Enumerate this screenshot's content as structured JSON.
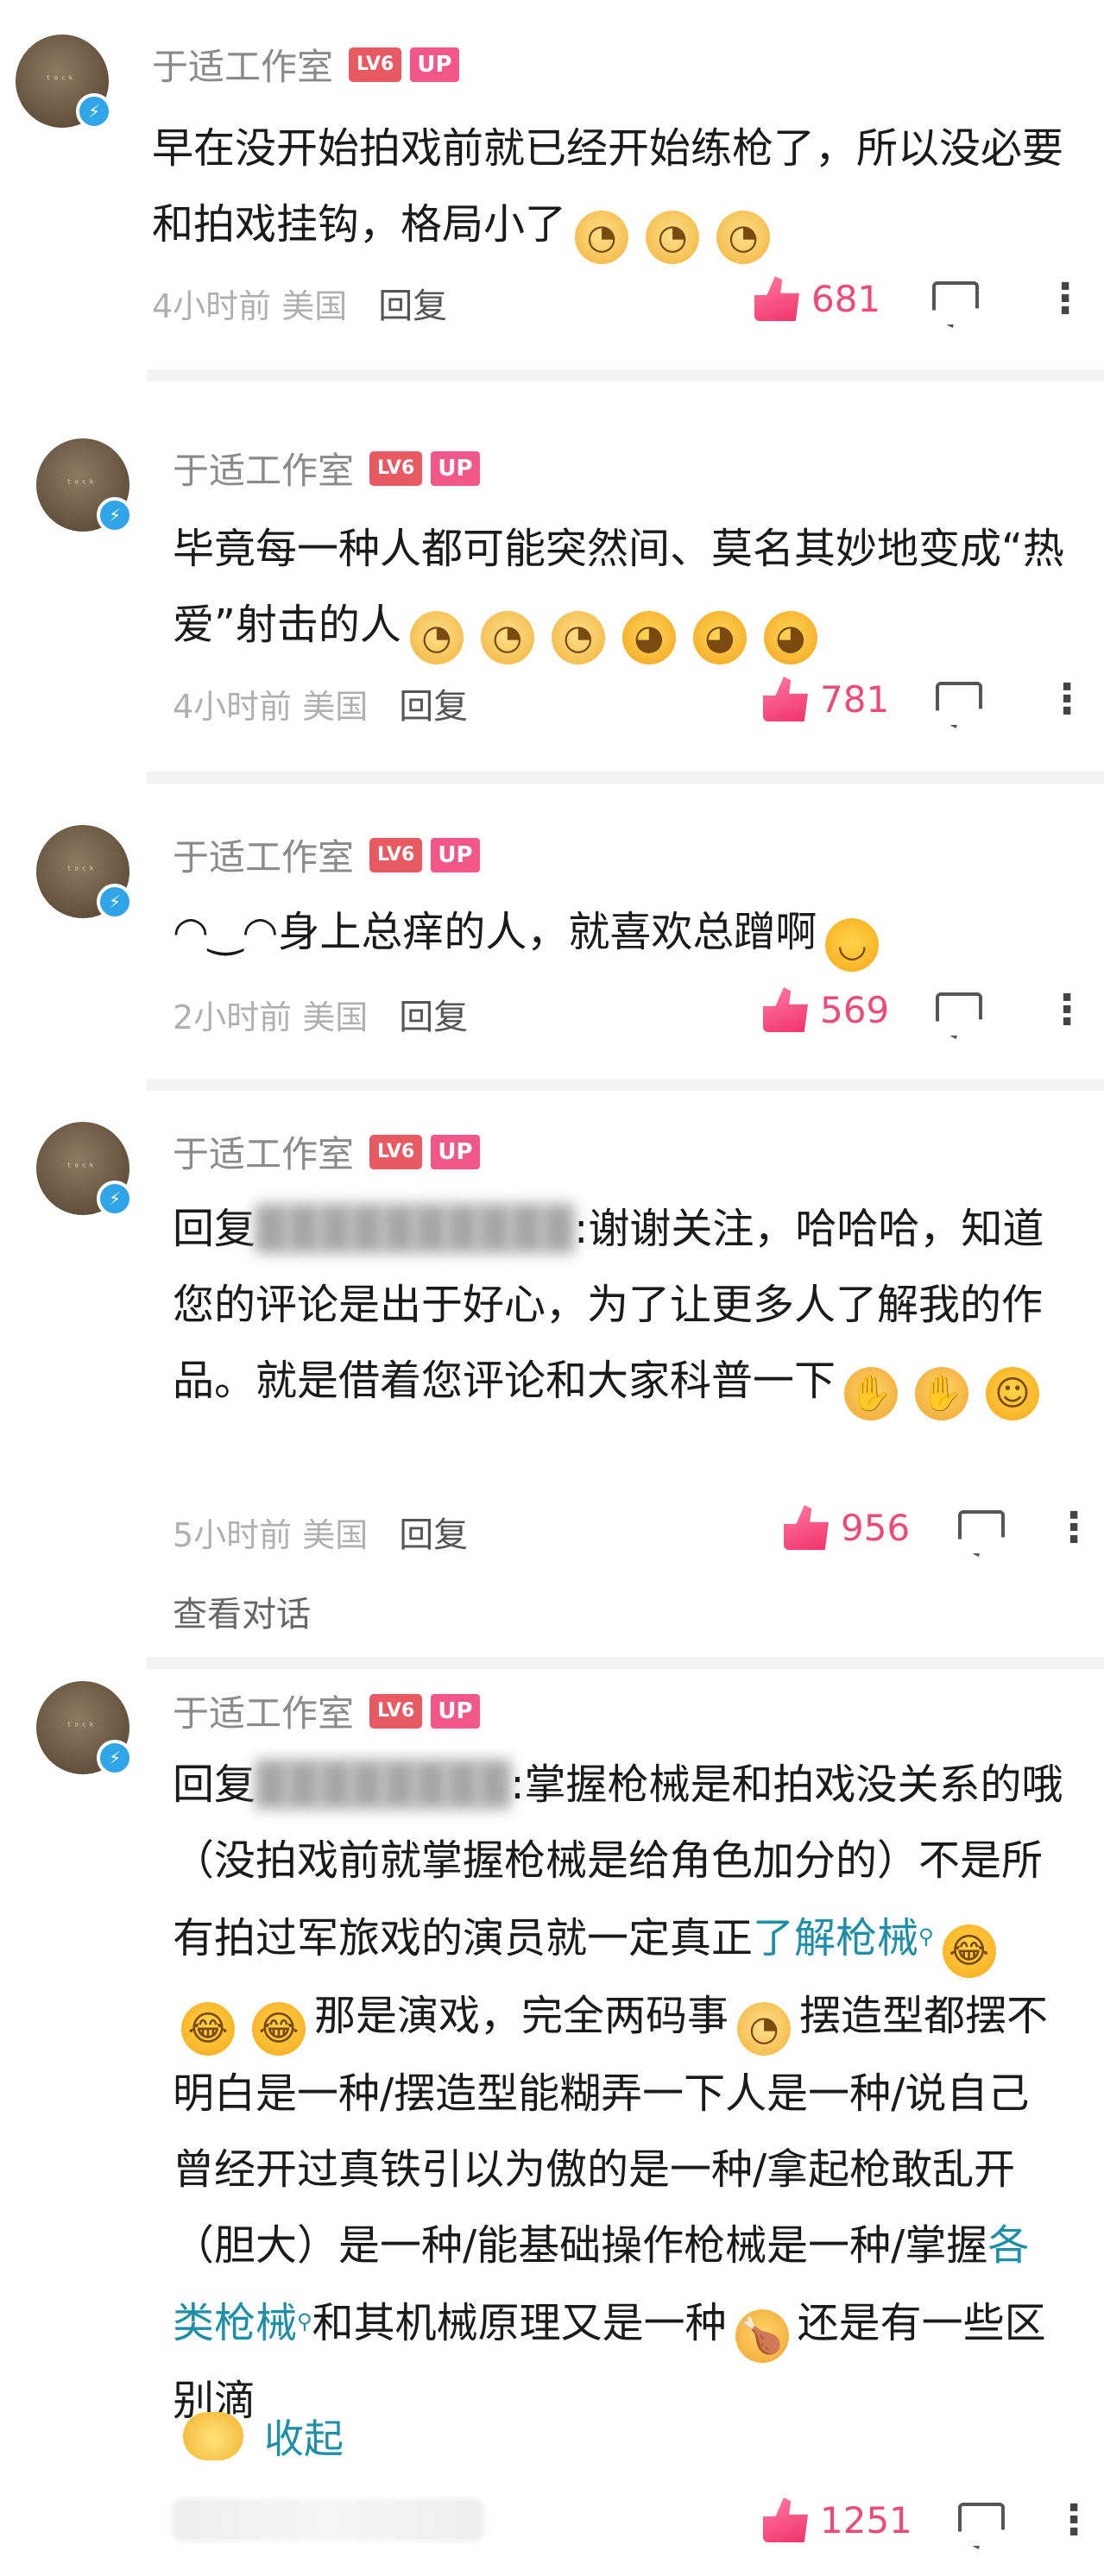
{
  "comments": [
    {
      "author": "于适工作室",
      "level": "LV6",
      "up_badge": "UP",
      "text": "早在没开始拍戏前就已经开始练枪了，所以没必要和拍戏挂钩，格局小了",
      "time_location": "4小时前 美国",
      "reply_label": "回复",
      "likes": "681"
    },
    {
      "author": "于适工作室",
      "level": "LV6",
      "up_badge": "UP",
      "text": "毕竟每一种人都可能突然间、莫名其妙地变成“热爱”射击的人",
      "time_location": "4小时前 美国",
      "reply_label": "回复",
      "likes": "781"
    },
    {
      "author": "于适工作室",
      "level": "LV6",
      "up_badge": "UP",
      "text": "◠‿◠身上总痒的人，就喜欢总蹭啊",
      "time_location": "2小时前 美国",
      "reply_label": "回复",
      "likes": "569"
    },
    {
      "author": "于适工作室",
      "level": "LV6",
      "up_badge": "UP",
      "reply_prefix": "回复",
      "blurred_user": "██████████",
      "text": ":谢谢关注，哈哈哈，知道您的评论是出于好心，为了让更多人了解我的作品。就是借着您评论和大家科普一下",
      "time_location": "5小时前 美国",
      "reply_label": "回复",
      "likes": "956",
      "view_thread": "查看对话"
    },
    {
      "author": "于适工作室",
      "level": "LV6",
      "up_badge": "UP",
      "reply_prefix": "回复",
      "blurred_user": "████████",
      "text_1": ":掌握枪械是和拍戏没关系的哦（没拍戏前就掌握枪械是给角色加分的）不是所有拍过军旅戏的演员就一定真正",
      "link_1": "了解枪械",
      "text_2": "那是演戏，完全两码事",
      "text_3": "摆造型都摆不明白是一种/摆造型能糊弄一下人是一种/说自己曾经开过真铁引以为傲的是一种/拿起枪敢乱开（胆大）是一种/能基础操作枪械是一种/掌握",
      "link_2": "各类枪械",
      "text_4": "和其机械原理又是一种",
      "text_5": "还是有一些区别滴",
      "collapse_label": "收起",
      "likes": "1251"
    }
  ]
}
